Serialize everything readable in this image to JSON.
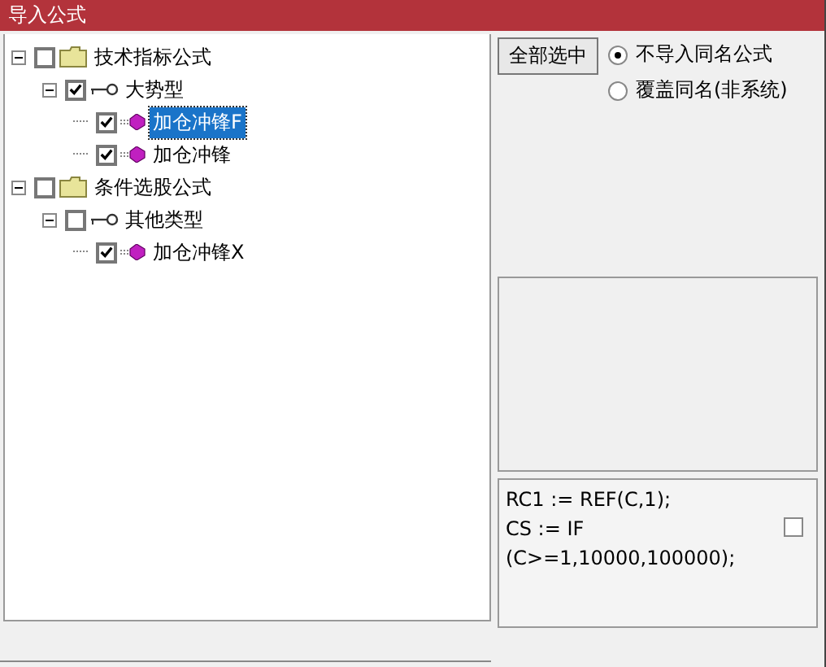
{
  "window": {
    "title": "导入公式"
  },
  "tree": [
    {
      "label": "技术指标公式",
      "kind": "folder",
      "checked": false,
      "expanded": true,
      "selected": false,
      "children": [
        {
          "label": "大势型",
          "kind": "key",
          "checked": true,
          "expanded": true,
          "selected": false,
          "children": [
            {
              "label": "加仓冲锋F",
              "kind": "formula",
              "checked": true,
              "selected": true
            },
            {
              "label": "加仓冲锋",
              "kind": "formula",
              "checked": true,
              "selected": false
            }
          ]
        }
      ]
    },
    {
      "label": "条件选股公式",
      "kind": "folder",
      "checked": false,
      "expanded": true,
      "selected": false,
      "children": [
        {
          "label": "其他类型",
          "kind": "key",
          "checked": false,
          "expanded": true,
          "selected": false,
          "children": [
            {
              "label": "加仓冲锋X",
              "kind": "formula",
              "checked": true,
              "selected": false
            }
          ]
        }
      ]
    }
  ],
  "select_all_button": "全部选中",
  "options": [
    {
      "label": "不导入同名公式",
      "selected": true
    },
    {
      "label": "覆盖同名(非系统)",
      "selected": false
    }
  ],
  "code": {
    "lines": [
      "RC1 := REF(C,1);",
      "CS := IF",
      "(C>=1,10000,100000);"
    ],
    "checked": false
  }
}
